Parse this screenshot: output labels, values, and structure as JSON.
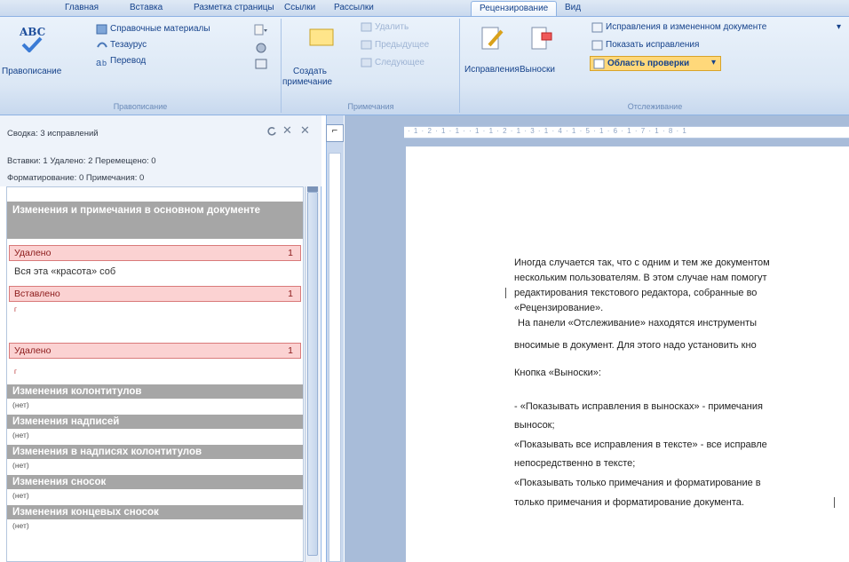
{
  "ribbon": {
    "tabs": [
      "Главная",
      "Вставка",
      "Разметка страницы",
      "Ссылки",
      "Рассылки",
      "Рецензирование",
      "Вид"
    ],
    "active_tab": "Рецензирование",
    "spelling_group": {
      "label": "Правописание",
      "spelling_button": "Правописание",
      "research": "Справочные материалы",
      "thesaurus": "Тезаурус",
      "translate": "Перевод",
      "abc_icon_text": "ABC"
    },
    "comments_group": {
      "label": "Примечания",
      "new_comment_line1": "Создать",
      "new_comment_line2": "примечание",
      "delete": "Удалить",
      "previous": "Предыдущее",
      "next": "Следующее"
    },
    "tracking_group": {
      "label": "Отслеживание",
      "track_changes": "Исправления",
      "balloons": "Выноски",
      "display_for_review": "Исправления в измененном документе",
      "show_markup": "Показать исправления",
      "reviewing_pane": "Область проверки"
    }
  },
  "review_pane": {
    "summary_title": "Сводка: 3 исправлений",
    "summary_line1": "Вставки: 1 Удалено: 2 Перемещено: 0",
    "summary_line2": "Форматирование: 0 Примечания: 0",
    "sections": {
      "main": "Изменения и примечания в основном документе",
      "headers": "Изменения колонтитулов",
      "textboxes": "Изменения надписей",
      "header_textboxes": "Изменения в надписях колонтитулов",
      "footnotes": "Изменения сносок",
      "endnotes": "Изменения концевых сносок"
    },
    "none_label": "(нет)",
    "revisions": [
      {
        "type": "Удалено",
        "number": "1",
        "text": "Вся эта «красота» соб"
      },
      {
        "type": "Вставлено",
        "number": "1",
        "text": "г"
      },
      {
        "type": "Удалено",
        "number": "1",
        "text": "г"
      }
    ]
  },
  "document": {
    "lines": [
      "Иногда случается так, что с одним и тем же документом",
      "нескольким пользователям. В этом случае нам помогут",
      "редактирования текстового редактора, собранные во",
      "«Рецензирование».",
      "На панели «Отслеживание» находятся инструменты",
      "вносимые в документ. Для этого надо установить кно",
      "Кнопка «Выноски»:",
      "- «Показывать исправления в выносках» - примечания",
      "выносок;",
      "«Показывать все исправления в тексте» - все исправле",
      "непосредственно в тексте;",
      "«Показывать только примечания и форматирование в",
      "только примечания и форматирование документа."
    ],
    "ruler_text": "· 1 · 2 · 1 · 1 · · 1 · 1 · 2 · 1 · 3 · 1 · 4 · 1 · 5 · 1 · 6 · 1 · 7 · 1 · 8 · 1"
  },
  "colors": {
    "ribbon_blue": "#dbe7f5",
    "header_gray": "#a6a6a6",
    "revision_pink": "#fbd2d2",
    "highlight_orange": "#ffd87a"
  }
}
